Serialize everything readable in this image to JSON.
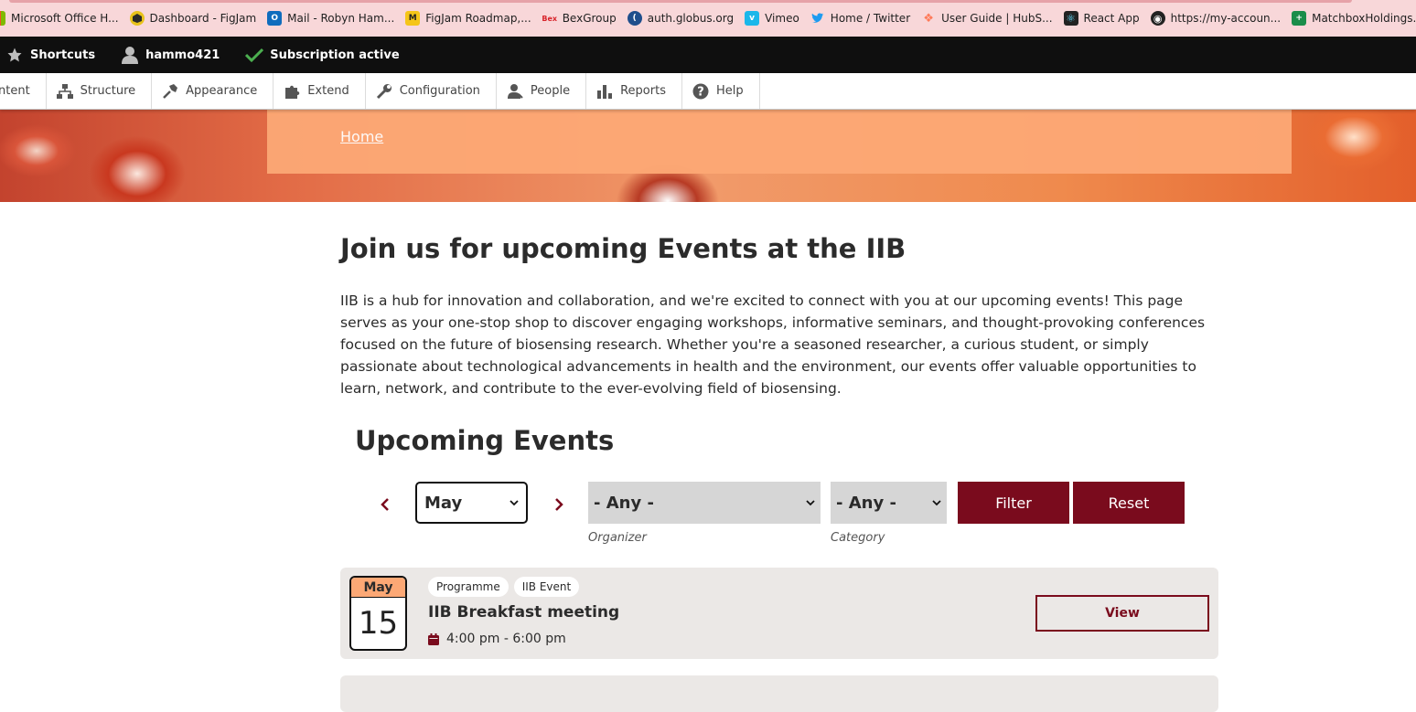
{
  "bookmarks": [
    {
      "label": "Microsoft Office H...",
      "icon": "microsoft-office-icon",
      "color": "#e84f24"
    },
    {
      "label": "Dashboard - FigJam",
      "icon": "figjam-dashboard-icon",
      "color": "#3b3b3b"
    },
    {
      "label": "Mail - Robyn Ham...",
      "icon": "outlook-icon",
      "color": "#0f6cbd"
    },
    {
      "label": "FigJam Roadmap,...",
      "icon": "figjam-icon",
      "color": "#f5c518"
    },
    {
      "label": "BexGroup",
      "icon": "bex-icon",
      "color": "#d8232a"
    },
    {
      "label": "auth.globus.org",
      "icon": "globus-icon",
      "color": "#1f4e8c"
    },
    {
      "label": "Vimeo",
      "icon": "vimeo-icon",
      "color": "#1ab7ea"
    },
    {
      "label": "Home / Twitter",
      "icon": "twitter-icon",
      "color": "#1d9bf0"
    },
    {
      "label": "User Guide | HubS...",
      "icon": "hubspot-icon",
      "color": "#ff7a59"
    },
    {
      "label": "React App",
      "icon": "react-icon",
      "color": "#222222"
    },
    {
      "label": "https://my-accoun...",
      "icon": "globe-icon",
      "color": "#222222"
    },
    {
      "label": "MatchboxHoldings...",
      "icon": "sheets-icon",
      "color": "#1a8d4a"
    }
  ],
  "admin_bar": {
    "shortcuts": "Shortcuts",
    "user": "hammo421",
    "subscription": "Subscription active"
  },
  "admin_menu": [
    {
      "label": "ntent",
      "icon": "content-icon"
    },
    {
      "label": "Structure",
      "icon": "structure-icon"
    },
    {
      "label": "Appearance",
      "icon": "appearance-icon"
    },
    {
      "label": "Extend",
      "icon": "extend-icon"
    },
    {
      "label": "Configuration",
      "icon": "configuration-icon"
    },
    {
      "label": "People",
      "icon": "people-icon"
    },
    {
      "label": "Reports",
      "icon": "reports-icon"
    },
    {
      "label": "Help",
      "icon": "help-icon"
    }
  ],
  "breadcrumb": {
    "home": "Home"
  },
  "page": {
    "title": "Join us for upcoming Events at the IIB",
    "intro": "IIB is a hub for innovation and collaboration, and we're excited to connect with you at our upcoming events! This page serves as your one-stop shop to discover engaging workshops, informative seminars, and thought-provoking conferences focused on the future of biosensing research. Whether you're a seasoned researcher, a curious student, or simply passionate about technological advancements in health and the environment, our events offer valuable opportunities to learn, network, and contribute to the ever-evolving field of biosensing.",
    "section_title": "Upcoming Events"
  },
  "filters": {
    "month": "May",
    "organizer": "- Any -",
    "organizer_caption": "Organizer",
    "category": "- Any -",
    "category_caption": "Category",
    "filter_label": "Filter",
    "reset_label": "Reset"
  },
  "events": [
    {
      "month": "May",
      "day": "15",
      "tags": [
        "Programme",
        "IIB Event"
      ],
      "title": "IIB Breakfast meeting",
      "time": "4:00 pm - 6:00 pm",
      "view_label": "View"
    }
  ],
  "colors": {
    "brand_dark_red": "#7a0b1d",
    "accent_peach": "#fca875",
    "card_bg": "#ebe8e6",
    "admin_bar_bg": "#0f0f0f"
  }
}
